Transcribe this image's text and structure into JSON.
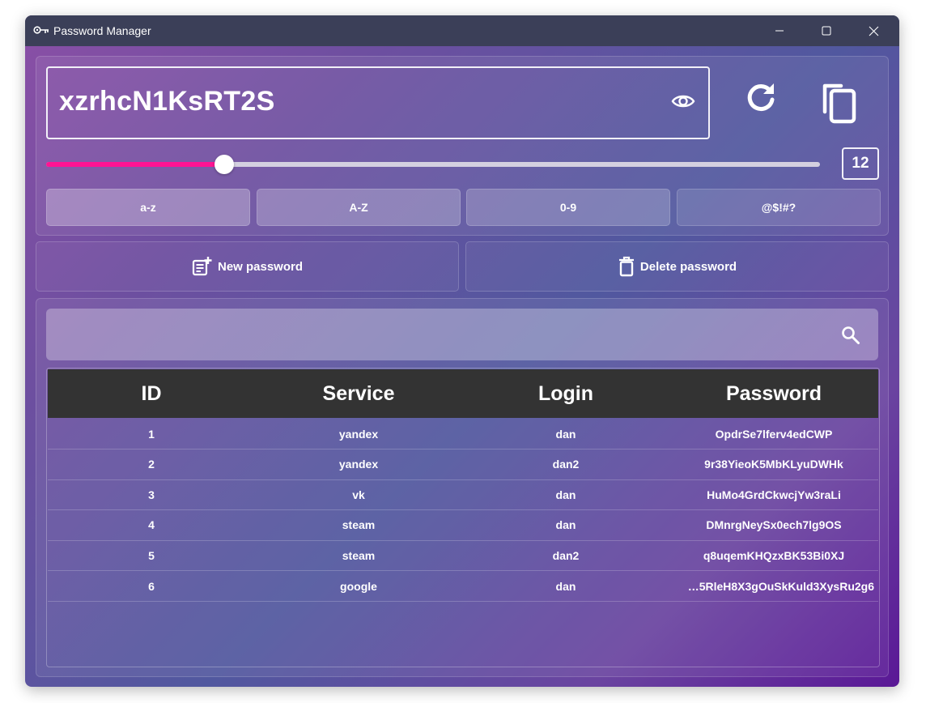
{
  "window": {
    "title": "Password Manager"
  },
  "generator": {
    "password": "xzrhcN1KsRT2S",
    "length": "12",
    "length_fraction": 0.23,
    "charsets": [
      {
        "label": "a-z",
        "bg": "rgba(255,255,255,0.28)"
      },
      {
        "label": "A-Z",
        "bg": "rgba(255,255,255,0.24)"
      },
      {
        "label": "0-9",
        "bg": "rgba(255,255,255,0.20)"
      },
      {
        "label": "@$!#?",
        "bg": "rgba(255,255,255,0.12)"
      }
    ]
  },
  "actions": {
    "new_label": "New password",
    "delete_label": "Delete password"
  },
  "search": {
    "placeholder": ""
  },
  "table": {
    "columns": [
      "ID",
      "Service",
      "Login",
      "Password"
    ],
    "rows": [
      [
        "1",
        "yandex",
        "dan",
        "OpdrSe7lferv4edCWP"
      ],
      [
        "2",
        "yandex",
        "dan2",
        "9r38YieoK5MbKLyuDWHk"
      ],
      [
        "3",
        "vk",
        "dan",
        "HuMo4GrdCkwcjYw3raLi"
      ],
      [
        "4",
        "steam",
        "dan",
        "DMnrgNeySx0ech7lg9OS"
      ],
      [
        "5",
        "steam",
        "dan2",
        "q8uqemKHQzxBK53Bi0XJ"
      ],
      [
        "6",
        "google",
        "dan",
        "…5RleH8X3gOuSkKuld3XysRu2g6"
      ]
    ]
  },
  "colors": {
    "titlebar": "#3b3f58",
    "slider_fill": "#ff1493",
    "table_header": "#333333"
  },
  "icons": [
    "key-icon",
    "minimize-icon",
    "maximize-icon",
    "close-icon",
    "eye-icon",
    "refresh-icon",
    "copy-icon",
    "note-add-icon",
    "trash-icon",
    "search-icon"
  ]
}
